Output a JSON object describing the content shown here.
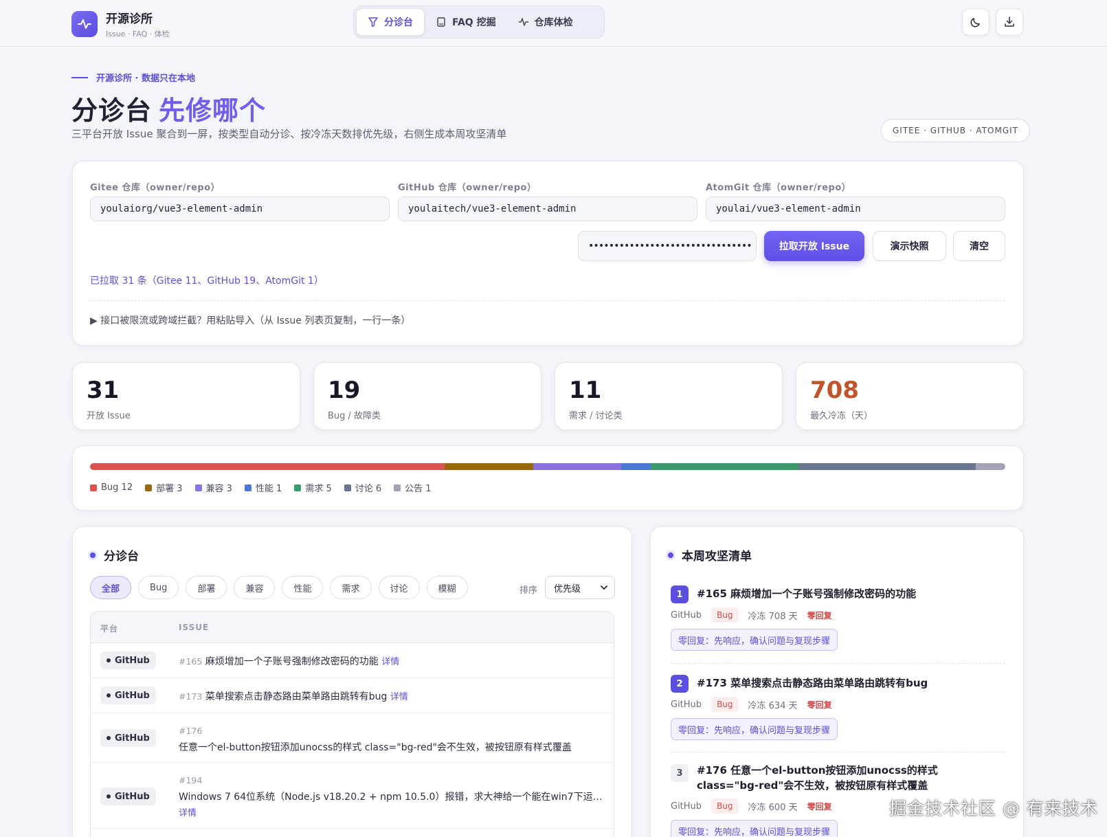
{
  "brand": {
    "title": "开源诊所",
    "subtitle": "Issue · FAQ · 体检",
    "icon": "pulse-icon",
    "accent": "#6e5ff0"
  },
  "nav": {
    "tabs": [
      {
        "label": "分诊台",
        "icon": "filter-icon",
        "active": true
      },
      {
        "label": "FAQ 挖掘",
        "icon": "book-icon",
        "active": false
      },
      {
        "label": "仓库体检",
        "icon": "pulse-icon",
        "active": false
      }
    ]
  },
  "toolbar": {
    "theme_icon": "moon-icon",
    "export_icon": "download-icon"
  },
  "hero": {
    "eyebrow": "开源诊所 · 数据只在本地",
    "title": "分诊台",
    "title_accent": "先修哪个",
    "lead": "三平台开放 Issue 聚合到一屏，按类型自动分诊、按冷冻天数排优先级，右侧生成本周攻坚清单",
    "platforms": "GITEE · GITHUB · ATOMGIT"
  },
  "repos": {
    "gitee": {
      "label": "Gitee 仓库（owner/repo）",
      "value": "youlaiorg/vue3-element-admin"
    },
    "github": {
      "label": "GitHub 仓库（owner/repo）",
      "value": "youlaitech/vue3-element-admin"
    },
    "atomgit": {
      "label": "AtomGit 仓库（owner/repo）",
      "value": "youlai/vue3-element-admin"
    },
    "token_mask": "••••••••••••••••••••••••••••••••",
    "fetch_label": "拉取开放 Issue",
    "demo_label": "演示快照",
    "clear_label": "清空",
    "status": "已拉取 31 条（Gitee 11、GitHub 19、AtomGit 1）",
    "paste_hint": "▶ 接口被限流或跨域拦截？用粘贴导入（从 Issue 列表页复制，一行一条）"
  },
  "stats": [
    {
      "value": "31",
      "label": "开放 Issue",
      "color": "#161827"
    },
    {
      "value": "19",
      "label": "Bug / 故障类",
      "color": "#161827"
    },
    {
      "value": "11",
      "label": "需求 / 讨论类",
      "color": "#161827"
    },
    {
      "value": "708",
      "label": "最久冷冻（天）",
      "color": "#c2542b"
    }
  ],
  "distribution": [
    {
      "label": "Bug 12",
      "count": 12,
      "color": "#d9534f"
    },
    {
      "label": "部署 3",
      "count": 3,
      "color": "#9a6a0a"
    },
    {
      "label": "兼容 3",
      "count": 3,
      "color": "#8a72e0"
    },
    {
      "label": "性能 1",
      "count": 1,
      "color": "#4a78d4"
    },
    {
      "label": "需求 5",
      "count": 5,
      "color": "#3a9a6c"
    },
    {
      "label": "讨论 6",
      "count": 6,
      "color": "#6a7590"
    },
    {
      "label": "公告 1",
      "count": 1,
      "color": "#a3a3b8"
    }
  ],
  "triage": {
    "title": "分诊台",
    "filters": [
      "全部",
      "Bug",
      "部署",
      "兼容",
      "性能",
      "需求",
      "讨论",
      "模糊"
    ],
    "sort_label": "排序",
    "sort_value": "优先级",
    "col_platform": "平台",
    "col_issue": "ISSUE",
    "rows": [
      {
        "platform": "GitHub",
        "num": "#165",
        "title": "麻烦增加一个子账号强制修改密码的功能",
        "link": "详情"
      },
      {
        "platform": "GitHub",
        "num": "#173",
        "title": "菜单搜索点击静态路由菜单路由跳转有bug",
        "link": "详情"
      },
      {
        "platform": "GitHub",
        "num": "#176",
        "title": "任意一个el-button按钮添加unocss的样式 class=\"bg-red\"会不生效，被按钮原有样式覆盖",
        "link": ""
      },
      {
        "platform": "GitHub",
        "num": "#194",
        "title": "Windows 7 64位系统（Node.js v18.20.2 + npm 10.5.0）报错，求大神给一个能在win7下运…",
        "link": "详情"
      }
    ]
  },
  "plan": {
    "title": "本周攻坚清单",
    "items": [
      {
        "rank": "1",
        "title": "#165 麻烦增加一个子账号强制修改密码的功能",
        "platform": "GitHub",
        "tag": "Bug",
        "frozen": "冷冻 708 天",
        "zero": "零回复",
        "advice": "零回复：先响应，确认问题与复现步骤"
      },
      {
        "rank": "2",
        "title": "#173 菜单搜索点击静态路由菜单路由跳转有bug",
        "platform": "GitHub",
        "tag": "Bug",
        "frozen": "冷冻 634 天",
        "zero": "零回复",
        "advice": "零回复：先响应，确认问题与复现步骤"
      },
      {
        "rank": "3",
        "title": "#176 任意一个el-button按钮添加unocss的样式 class=\"bg-red\"会不生效，被按钮原有样式覆盖",
        "platform": "GitHub",
        "tag": "Bug",
        "frozen": "冷冻 600 天",
        "zero": "零回复",
        "advice": "零回复：先响应，确认问题与复现步骤"
      }
    ]
  },
  "watermark": "掘金技术社区 @ 有来技术"
}
